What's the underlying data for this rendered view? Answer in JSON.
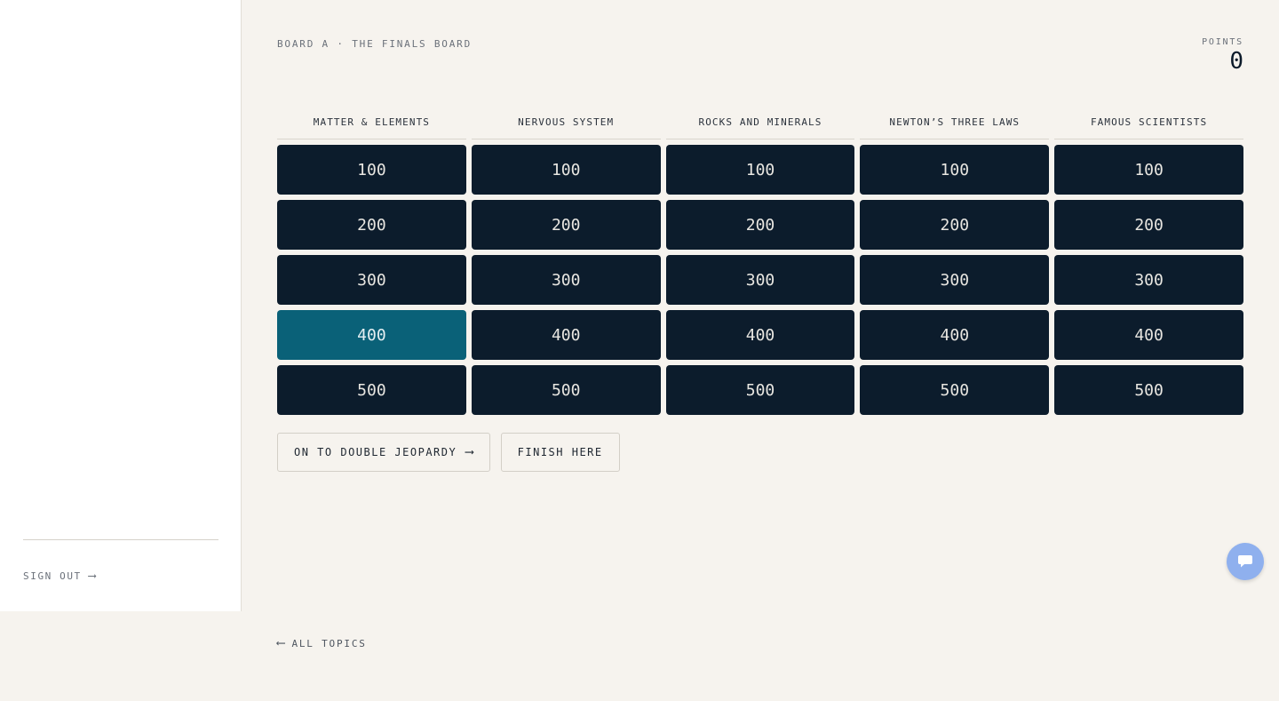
{
  "sidebar": {
    "sign_out_label": "SIGN OUT",
    "sign_out_arrow": "⟶"
  },
  "header": {
    "board_label": "BOARD A · THE FINALS BOARD",
    "points_label": "POINTS",
    "points_value": "0"
  },
  "board": {
    "categories": [
      {
        "name": "MATTER & ELEMENTS",
        "values": [
          "100",
          "200",
          "300",
          "400",
          "500"
        ]
      },
      {
        "name": "NERVOUS SYSTEM",
        "values": [
          "100",
          "200",
          "300",
          "400",
          "500"
        ]
      },
      {
        "name": "ROCKS AND MINERALS",
        "values": [
          "100",
          "200",
          "300",
          "400",
          "500"
        ]
      },
      {
        "name": "NEWTON’S THREE LAWS",
        "values": [
          "100",
          "200",
          "300",
          "400",
          "500"
        ]
      },
      {
        "name": "FAMOUS SCIENTISTS",
        "values": [
          "100",
          "200",
          "300",
          "400",
          "500"
        ]
      }
    ],
    "highlighted_tile": {
      "category": 0,
      "value": "400"
    },
    "tile_color": "#0c1c2c",
    "highlight_color": "#0a6178"
  },
  "actions": {
    "double_jeopardy_label": "ON TO DOUBLE JEOPARDY",
    "double_jeopardy_arrow": "⟶",
    "finish_label": "FINISH HERE"
  },
  "footer": {
    "all_topics_arrow": "⟵",
    "all_topics_label": "ALL TOPICS"
  },
  "chat": {
    "icon": "chat-bubble-icon",
    "color": "#8fb0ee"
  }
}
